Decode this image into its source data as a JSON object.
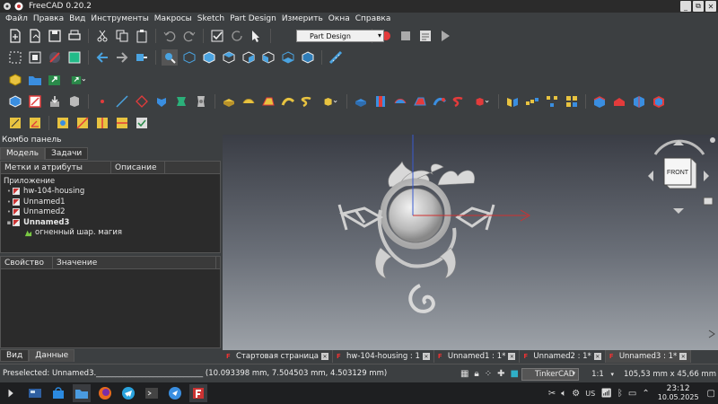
{
  "window": {
    "title": "FreeCAD 0.20.2",
    "minimize": "_",
    "restore": "⧉",
    "close": "✕"
  },
  "menubar": [
    "Файл",
    "Правка",
    "Вид",
    "Инструменты",
    "Макросы",
    "Sketch",
    "Part Design",
    "Измерить",
    "Окна",
    "Справка"
  ],
  "workbench": {
    "selected": "Part Design"
  },
  "combo": {
    "title": "Комбо панель",
    "tabs": [
      "Модель",
      "Задачи"
    ],
    "tree_headers": [
      "Метки и атрибуты",
      "Описание"
    ],
    "root_label": "Приложение",
    "items": [
      {
        "label": "hw-104-housing",
        "twist": "•",
        "bold": false
      },
      {
        "label": "Unnamed1",
        "twist": "•",
        "bold": false
      },
      {
        "label": "Unnamed2",
        "twist": "•",
        "bold": false
      },
      {
        "label": "Unnamed3",
        "twist": "▪",
        "bold": true
      }
    ],
    "child_item": "огненный шар. магия",
    "prop_headers": [
      "Свойство",
      "Значение"
    ],
    "bottom_tabs": [
      "Вид",
      "Данные"
    ]
  },
  "viewport": {
    "navcube_face": "FRONT"
  },
  "doc_tabs": [
    {
      "label": "Стартовая страница",
      "active": false
    },
    {
      "label": "hw-104-housing : 1",
      "active": false
    },
    {
      "label": "Unnamed1 : 1*",
      "active": false
    },
    {
      "label": "Unnamed2 : 1*",
      "active": false
    },
    {
      "label": "Unnamed3 : 1*",
      "active": true
    }
  ],
  "statusbar": {
    "text": "Preselected: Unnamed3.____________________________ (10.093398 mm, 7.504503 mm, 4.503129 mm)",
    "nav_style": "TinkerCAD",
    "scale": "1:1",
    "dimensions": "105,53 mm x 45,66 mm"
  },
  "taskbar": {
    "keyboard": "US",
    "time": "23:12",
    "date": "10.05.2025"
  },
  "colors": {
    "accent": "#e33b3b",
    "background": "#3c3f41",
    "viewport_top": "#3a3d45",
    "viewport_bottom": "#9da2a8"
  }
}
